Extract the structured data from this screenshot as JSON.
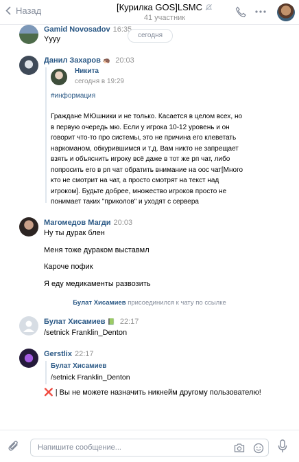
{
  "header": {
    "back_label": "Назад",
    "title": "[Курилка GOS]LSMC",
    "subtitle": "41 участник"
  },
  "date_divider": "сегодня",
  "messages": [
    {
      "author": "Gamid Novosadov",
      "time": "16:35",
      "lines": [
        "Yyyy"
      ]
    },
    {
      "author": "Данил Захаров",
      "emoji": "🦔",
      "time": "20:03",
      "quote": {
        "author": "Никита",
        "time": "сегодня в 19:29",
        "hashtag": "#информация",
        "lines": [
          "Граждане МЮшники и не только. Касается в целом всех, но",
          "в первую очередь мю. Если у игрока 10-12 уровень и он",
          "говорит что-то про системы, это не причина его клеветать",
          "наркоманом, обкурившимся и т.д. Вам никто не запрещает",
          "взять и объяснить игроку всё даже в тот же рп чат, либо",
          "попросить его в рп чат обратить внимание на оос чат[Много",
          "кто не смотрит на чат, а просто смотрят на текст над",
          "игроком]. Будьте добрее, множество игроков просто не",
          "понимает таких \"приколов\" и уходят с сервера"
        ]
      }
    },
    {
      "author": "Магомедов Магди",
      "time": "20:03",
      "lines": [
        "Ну ты дурак блен",
        "Меня тоже дураком выставмл",
        "Кароче пофик",
        "Я еду медикаменты развозить"
      ]
    },
    {
      "service_author": "Булат Хисамиев",
      "service_text": "присоединился к чату по ссылке"
    },
    {
      "author": "Булат Хисамиев",
      "emoji": "📗",
      "time": "22:17",
      "lines": [
        "/setnick Franklin_Denton"
      ]
    },
    {
      "author": "Gerstlix",
      "time": "22:17",
      "quote": {
        "author": "Булат Хисамиев",
        "lines": [
          "/setnick Franklin_Denton"
        ]
      },
      "lines": [
        "❌ | Вы не можете назначить никнейм другому пользователю!"
      ]
    }
  ],
  "composer": {
    "placeholder": "Напишите сообщение..."
  },
  "colors": {
    "link": "#2a5885",
    "muted": "#939393",
    "accent": "#5181b8"
  }
}
